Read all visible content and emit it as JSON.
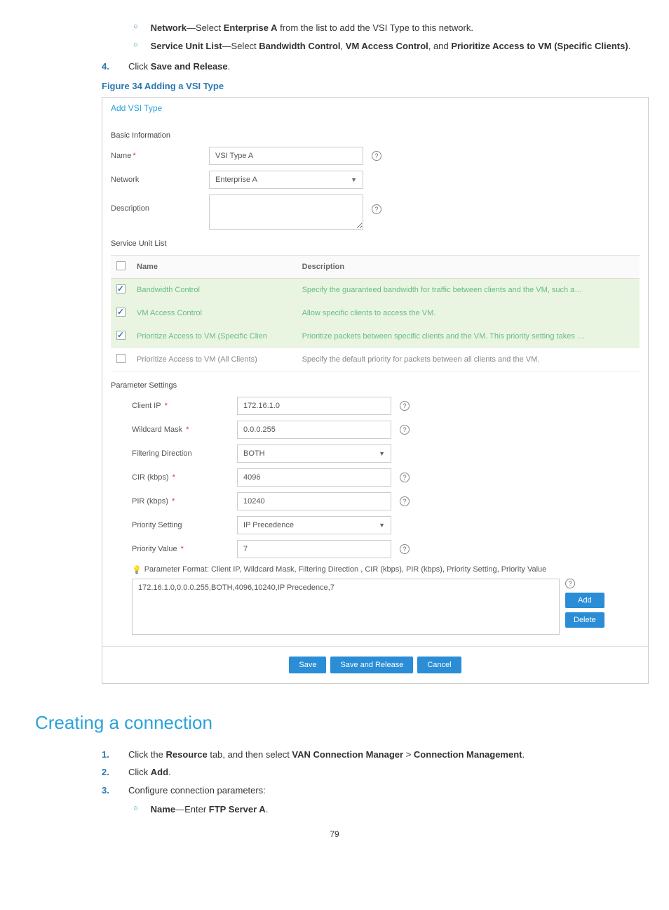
{
  "intro": {
    "bullets": [
      {
        "label": "Network",
        "sep": "—Select ",
        "value": "Enterprise A",
        "tail": " from the list to add the VSI Type to this network."
      },
      {
        "label": "Service Unit List",
        "sep": "—Select ",
        "value": "Bandwidth Control",
        "mid": ", ",
        "value2": "VM Access Control",
        "mid2": ", and ",
        "value3": "Prioritize Access to VM (Specific Clients)",
        "tail": "."
      }
    ],
    "step4_label": "4.",
    "step4_prefix": "Click ",
    "step4_value": "Save and Release",
    "step4_tail": "."
  },
  "figure_caption": "Figure 34 Adding a VSI Type",
  "panel": {
    "title": "Add VSI Type",
    "basic_header": "Basic Information",
    "name_label": "Name",
    "name_value": "VSI Type A",
    "network_label": "Network",
    "network_value": "Enterprise A",
    "description_label": "Description",
    "description_value": "",
    "svc_header": "Service Unit List",
    "svc_cols": {
      "name": "Name",
      "desc": "Description"
    },
    "svc_rows": [
      {
        "checked": true,
        "name": "Bandwidth Control",
        "desc": "Specify the guaranteed bandwidth for traffic between clients and the VM, such a…"
      },
      {
        "checked": true,
        "name": "VM Access Control",
        "desc": "Allow specific clients to access the VM."
      },
      {
        "checked": true,
        "name": "Prioritize Access to VM (Specific Clien",
        "desc": "Prioritize packets between specific clients and the VM. This priority setting takes …"
      },
      {
        "checked": false,
        "name": "Prioritize Access to VM (All Clients)",
        "desc": "Specify the default priority for packets between all clients and the VM."
      }
    ],
    "param_header": "Parameter Settings",
    "params": {
      "client_ip_label": "Client IP",
      "client_ip_value": "172.16.1.0",
      "wildcard_label": "Wildcard Mask",
      "wildcard_value": "0.0.0.255",
      "filter_label": "Filtering Direction",
      "filter_value": "BOTH",
      "cir_label": "CIR (kbps)",
      "cir_value": "4096",
      "pir_label": "PIR (kbps)",
      "pir_value": "10240",
      "priset_label": "Priority Setting",
      "priset_value": "IP Precedence",
      "prival_label": "Priority Value",
      "prival_value": "7"
    },
    "hint": "Parameter Format: Client IP,  Wildcard Mask,  Filtering Direction ,  CIR (kbps),  PIR (kbps),  Priority Setting,  Priority Value",
    "param_box_value": "172.16.1.0,0.0.0.255,BOTH,4096,10240,IP Precedence,7",
    "btn_add": "Add",
    "btn_delete": "Delete",
    "btn_save": "Save",
    "btn_save_release": "Save and Release",
    "btn_cancel": "Cancel"
  },
  "section_heading": "Creating a connection",
  "steps2": [
    {
      "num": "1.",
      "prefix": "Click the ",
      "b1": "Resource",
      "m1": " tab, and then select ",
      "b2": "VAN Connection Manager",
      "m2": " > ",
      "b3": "Connection Management",
      "tail": "."
    },
    {
      "num": "2.",
      "prefix": "Click ",
      "b1": "Add",
      "tail": "."
    },
    {
      "num": "3.",
      "prefix": "Configure connection parameters:",
      "tail": ""
    }
  ],
  "sub_bullet": {
    "label": "Name",
    "sep": "—Enter ",
    "value": "FTP Server A",
    "tail": "."
  },
  "page_number": "79"
}
